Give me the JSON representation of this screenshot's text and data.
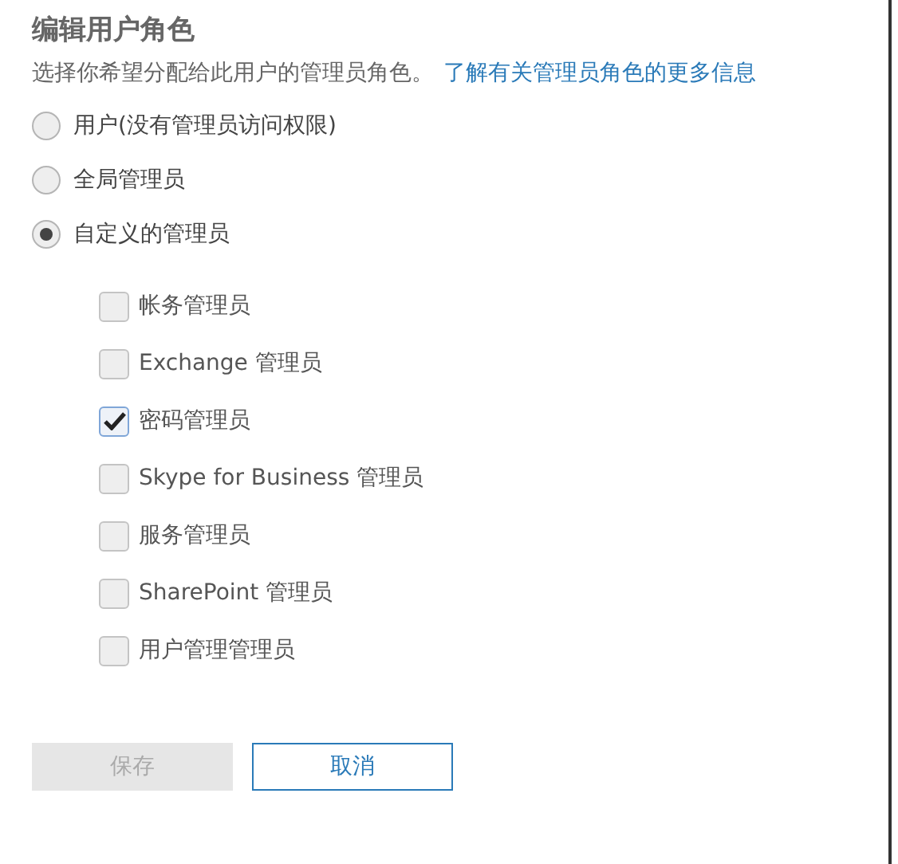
{
  "title": "编辑用户角色",
  "description": {
    "text": "选择你希望分配给此用户的管理员角色。",
    "link": "了解有关管理员角色的更多信息"
  },
  "roles": [
    {
      "label": "用户(没有管理员访问权限)",
      "selected": false
    },
    {
      "label": "全局管理员",
      "selected": false
    },
    {
      "label": "自定义的管理员",
      "selected": true
    }
  ],
  "custom_roles": [
    {
      "label": "帐务管理员",
      "checked": false
    },
    {
      "label": "Exchange 管理员",
      "checked": false
    },
    {
      "label": "密码管理员",
      "checked": true
    },
    {
      "label": "Skype for Business 管理员",
      "checked": false
    },
    {
      "label": "服务管理员",
      "checked": false
    },
    {
      "label": "SharePoint 管理员",
      "checked": false
    },
    {
      "label": "用户管理管理员",
      "checked": false
    }
  ],
  "buttons": [
    {
      "label": "保存",
      "disabled": true
    },
    {
      "label": "取消",
      "disabled": false
    }
  ]
}
